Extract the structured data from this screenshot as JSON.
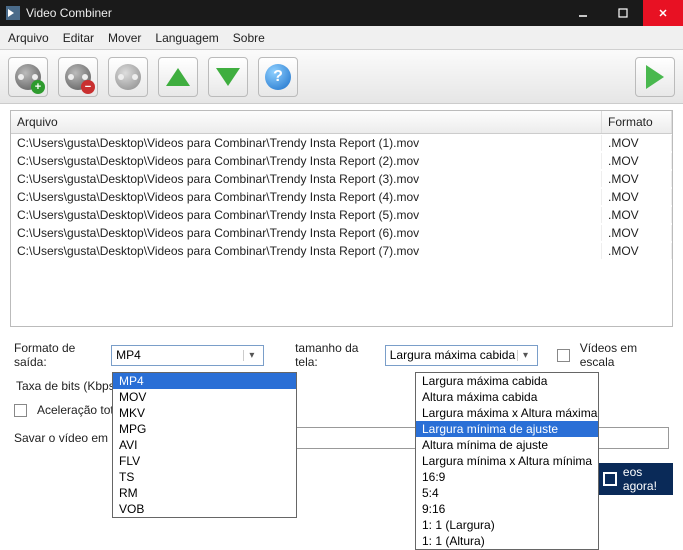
{
  "window": {
    "title": "Video Combiner"
  },
  "menu": {
    "arquivo": "Arquivo",
    "editar": "Editar",
    "mover": "Mover",
    "languagem": "Languagem",
    "sobre": "Sobre"
  },
  "table": {
    "headers": {
      "arquivo": "Arquivo",
      "formato": "Formato"
    },
    "rows": [
      {
        "path": "C:\\Users\\gusta\\Desktop\\Videos para Combinar\\Trendy Insta Report (1).mov",
        "fmt": ".MOV"
      },
      {
        "path": "C:\\Users\\gusta\\Desktop\\Videos para Combinar\\Trendy Insta Report (2).mov",
        "fmt": ".MOV"
      },
      {
        "path": "C:\\Users\\gusta\\Desktop\\Videos para Combinar\\Trendy Insta Report (3).mov",
        "fmt": ".MOV"
      },
      {
        "path": "C:\\Users\\gusta\\Desktop\\Videos para Combinar\\Trendy Insta Report (4).mov",
        "fmt": ".MOV"
      },
      {
        "path": "C:\\Users\\gusta\\Desktop\\Videos para Combinar\\Trendy Insta Report (5).mov",
        "fmt": ".MOV"
      },
      {
        "path": "C:\\Users\\gusta\\Desktop\\Videos para Combinar\\Trendy Insta Report (6).mov",
        "fmt": ".MOV"
      },
      {
        "path": "C:\\Users\\gusta\\Desktop\\Videos para Combinar\\Trendy Insta Report (7).mov",
        "fmt": ".MOV"
      }
    ]
  },
  "controls": {
    "output_format_label": "Formato de saída:",
    "output_format_value": "MP4",
    "screen_size_label": "tamanho da tela:",
    "screen_size_value": "Largura máxima cabida",
    "scale_videos_label": "Vídeos em escala",
    "bitrate_label": "Taxa de bits (Kbps):",
    "accel_label": "Aceleração total (",
    "save_label": "Savar o vídeo em",
    "combine_button": "eos agora!"
  },
  "format_options": [
    "MP4",
    "MOV",
    "MKV",
    "MPG",
    "AVI",
    "FLV",
    "TS",
    "RM",
    "VOB"
  ],
  "format_selected": "MP4",
  "screen_options": [
    "Largura máxima cabida",
    "Altura máxima cabida",
    "Largura máxima x Altura máxima",
    "Largura mínima de ajuste",
    "Altura mínima de ajuste",
    "Largura mínima x Altura mínima",
    "16:9",
    "5:4",
    "9:16",
    "1: 1 (Largura)",
    "1: 1 (Altura)"
  ],
  "screen_selected": "Largura mínima de ajuste"
}
